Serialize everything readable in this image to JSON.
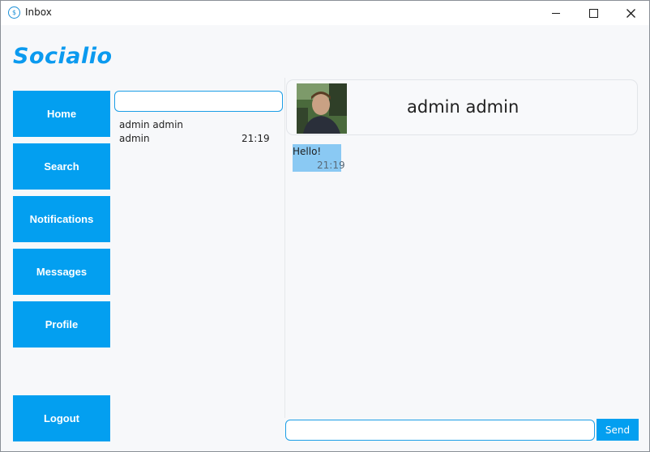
{
  "window": {
    "title": "Inbox"
  },
  "brand": "Socialio",
  "nav": {
    "home": "Home",
    "search": "Search",
    "notifications": "Notifications",
    "messages": "Messages",
    "profile": "Profile",
    "logout": "Logout"
  },
  "conversations": {
    "search_value": "",
    "items": [
      {
        "name": "admin admin",
        "last_sender": "admin",
        "time": "21:19"
      }
    ]
  },
  "chat": {
    "contact_name": "admin admin",
    "messages": [
      {
        "text": "Hello!",
        "time": "21:19"
      }
    ],
    "input_value": "",
    "send_label": "Send"
  },
  "colors": {
    "accent": "#039ff0",
    "brand": "#0b9aef",
    "bubble": "#8ac9f3",
    "background": "#f7f8fa"
  },
  "icons": [
    "app-icon",
    "minimize-icon",
    "maximize-icon",
    "close-icon"
  ]
}
